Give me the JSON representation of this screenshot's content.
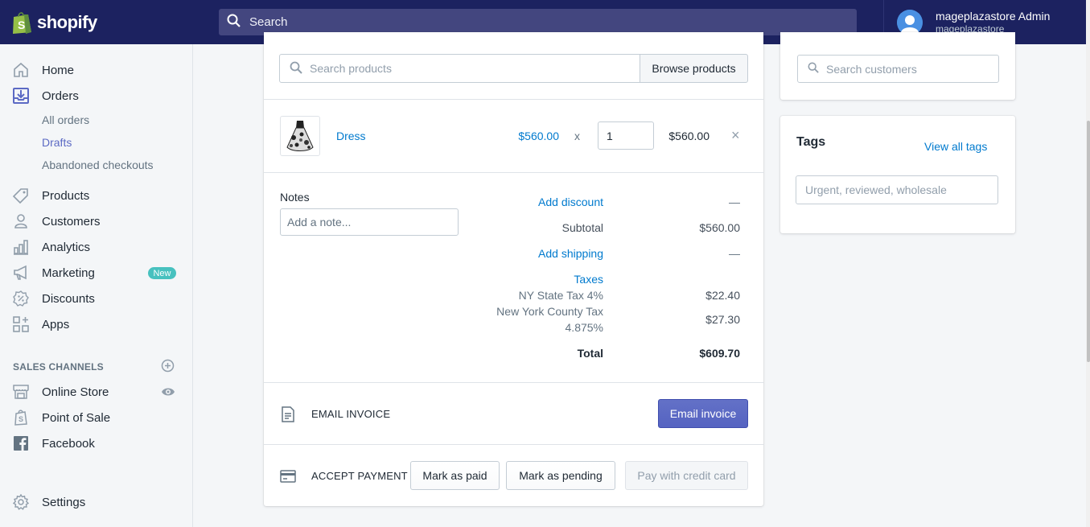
{
  "topbar": {
    "brand": "shopify",
    "search_label": "Search",
    "account_name": "mageplazastore Admin",
    "account_store": "mageplazastore"
  },
  "sidebar": {
    "items": [
      {
        "label": "Home"
      },
      {
        "label": "Orders"
      },
      {
        "label": "Products"
      },
      {
        "label": "Customers"
      },
      {
        "label": "Analytics"
      },
      {
        "label": "Marketing",
        "badge": "New"
      },
      {
        "label": "Discounts"
      },
      {
        "label": "Apps"
      }
    ],
    "order_subitems": [
      "All orders",
      "Drafts",
      "Abandoned checkouts"
    ],
    "sales_channels_title": "SALES CHANNELS",
    "channels": [
      "Online Store",
      "Point of Sale",
      "Facebook"
    ],
    "settings_label": "Settings"
  },
  "order": {
    "search_placeholder": "Search products",
    "browse_label": "Browse products",
    "line_item": {
      "name": "Dress",
      "unit_price": "$560.00",
      "times": "x",
      "quantity": "1",
      "line_total": "$560.00",
      "remove": "×"
    },
    "notes_label": "Notes",
    "notes_placeholder": "Add a note...",
    "summary": {
      "add_discount": "Add discount",
      "discount_value": "—",
      "subtotal_label": "Subtotal",
      "subtotal_value": "$560.00",
      "add_shipping": "Add shipping",
      "shipping_value": "—",
      "taxes_label": "Taxes",
      "tax1_label": "NY State Tax 4%",
      "tax1_value": "$22.40",
      "tax2_label_line1": "New York County Tax",
      "tax2_label_line2": "4.875%",
      "tax2_value": "$27.30",
      "total_label": "Total",
      "total_value": "$609.70"
    },
    "email_invoice_title": "EMAIL INVOICE",
    "email_invoice_button": "Email invoice",
    "accept_payment_title": "ACCEPT PAYMENT",
    "mark_paid": "Mark as paid",
    "mark_pending": "Mark as pending",
    "pay_credit": "Pay with credit card"
  },
  "customer": {
    "search_placeholder": "Search customers"
  },
  "tags": {
    "title": "Tags",
    "view_all": "View all tags",
    "placeholder": "Urgent, reviewed, wholesale"
  },
  "colors": {
    "topbar": "#1c2260",
    "accent": "#5c6ac4",
    "link": "#007ace",
    "badge": "#47c1bf"
  }
}
